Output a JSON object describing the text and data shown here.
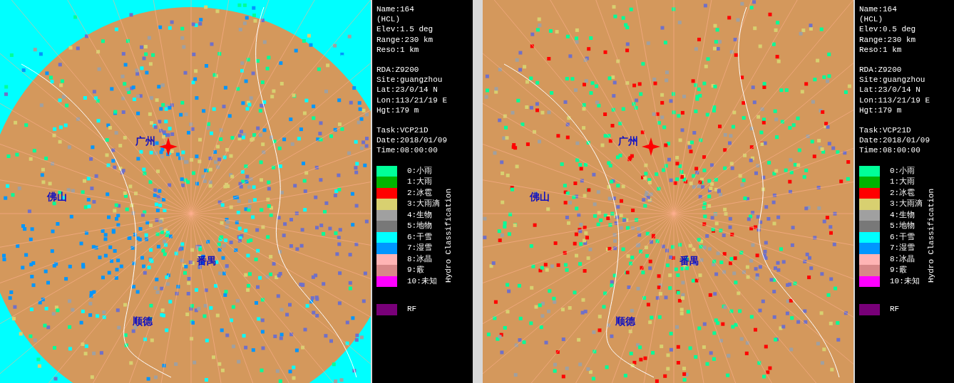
{
  "panels": [
    {
      "map": {
        "places": [
          "广州",
          "佛山",
          "番禺",
          "顺德"
        ]
      },
      "info_blocks": [
        [
          "Name:164",
          "(HCL)",
          "Elev:1.5 deg",
          "Range:230 km",
          "Reso:1 km"
        ],
        [
          "RDA:Z9200",
          "Site:guangzhou",
          "Lat:23/0/14 N",
          "Lon:113/21/19 E",
          "Hgt:179 m"
        ],
        [
          "Task:VCP21D",
          "Date:2018/01/09",
          "Time:08:00:00"
        ]
      ],
      "legend": {
        "title": "Hydro Classification",
        "items": [
          {
            "label": "0:小雨",
            "color": "#00ff99"
          },
          {
            "label": "1:大雨",
            "color": "#00b400"
          },
          {
            "label": "2:冰雹",
            "color": "#ff0000"
          },
          {
            "label": "3:大雨滴",
            "color": "#d8d070"
          },
          {
            "label": "4:生物",
            "color": "#a0a0a0"
          },
          {
            "label": "5:地物",
            "color": "#787878"
          },
          {
            "label": "6:干雪",
            "color": "#00ffff"
          },
          {
            "label": "7:湿雪",
            "color": "#0096ff"
          },
          {
            "label": "8:冰晶",
            "color": "#ffb4b4"
          },
          {
            "label": "9:霰",
            "color": "#d88888"
          },
          {
            "label": "10:未知",
            "color": "#ff00ff"
          }
        ],
        "rf": {
          "label": "RF",
          "color": "#780078"
        }
      }
    },
    {
      "map": {
        "places": [
          "广州",
          "佛山",
          "番禺",
          "顺德"
        ]
      },
      "info_blocks": [
        [
          "Name:164",
          "(HCL)",
          "Elev:0.5 deg",
          "Range:230 km",
          "Reso:1 km"
        ],
        [
          "RDA:Z9200",
          "Site:guangzhou",
          "Lat:23/0/14 N",
          "Lon:113/21/19 E",
          "Hgt:179 m"
        ],
        [
          "Task:VCP21D",
          "Date:2018/01/09",
          "Time:08:00:00"
        ]
      ],
      "legend": {
        "title": "Hydro Classification",
        "items": [
          {
            "label": "0:小雨",
            "color": "#00ff99"
          },
          {
            "label": "1:大雨",
            "color": "#00b400"
          },
          {
            "label": "2:冰雹",
            "color": "#ff0000"
          },
          {
            "label": "3:大雨滴",
            "color": "#d8d070"
          },
          {
            "label": "4:生物",
            "color": "#a0a0a0"
          },
          {
            "label": "5:地物",
            "color": "#787878"
          },
          {
            "label": "6:干雪",
            "color": "#00ffff"
          },
          {
            "label": "7:湿雪",
            "color": "#0096ff"
          },
          {
            "label": "8:冰晶",
            "color": "#ffb4b4"
          },
          {
            "label": "9:霰",
            "color": "#d88888"
          },
          {
            "label": "10:未知",
            "color": "#ff00ff"
          }
        ],
        "rf": {
          "label": "RF",
          "color": "#780078"
        }
      }
    }
  ]
}
